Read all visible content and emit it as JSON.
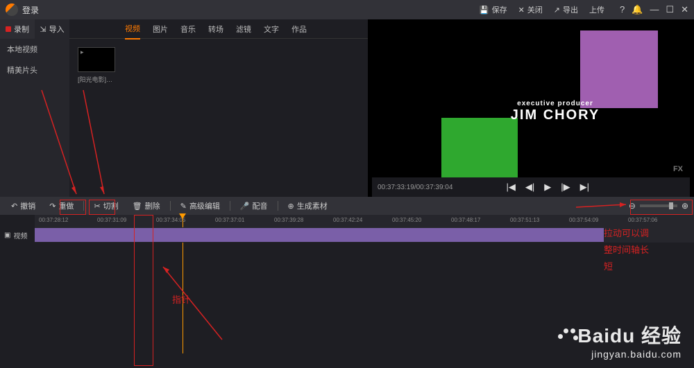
{
  "titlebar": {
    "title": "登录",
    "save": "保存",
    "close": "关闭",
    "export": "导出",
    "upload": "上传"
  },
  "leftcol": {
    "record": "录制",
    "import": "导入",
    "local": "本地视频",
    "opening": "精美片头"
  },
  "tabs": [
    "视频",
    "图片",
    "音乐",
    "转场",
    "滤镜",
    "文字",
    "作品"
  ],
  "media": {
    "name": "[阳光电影]www…"
  },
  "preview": {
    "credit_role": "executive producer",
    "credit_name": "JIM CHORY",
    "channel": "FX",
    "timecode": "00:37:33:19/00:37:39:04"
  },
  "toolbar": {
    "undo": "撤销",
    "redo": "重做",
    "cut": "切割",
    "delete": "删除",
    "advanced": "高级编辑",
    "dub": "配音",
    "generate": "生成素材"
  },
  "ruler": [
    "00:37:28:12",
    "00:37:31:09",
    "00:37:34:05",
    "00:37:37:01",
    "00:37:39:28",
    "00:37:42:24",
    "00:37:45:20",
    "00:37:48:17",
    "00:37:51:13",
    "00:37:54:09",
    "00:37:57:06"
  ],
  "track": {
    "label": "视频"
  },
  "annotations": {
    "right_text_1": "拉动可以调",
    "right_text_2": "整时间轴长",
    "right_text_3": "短",
    "pointer": "指针"
  },
  "watermark": {
    "brand": "Baidu 经验",
    "url": "jingyan.baidu.com"
  }
}
